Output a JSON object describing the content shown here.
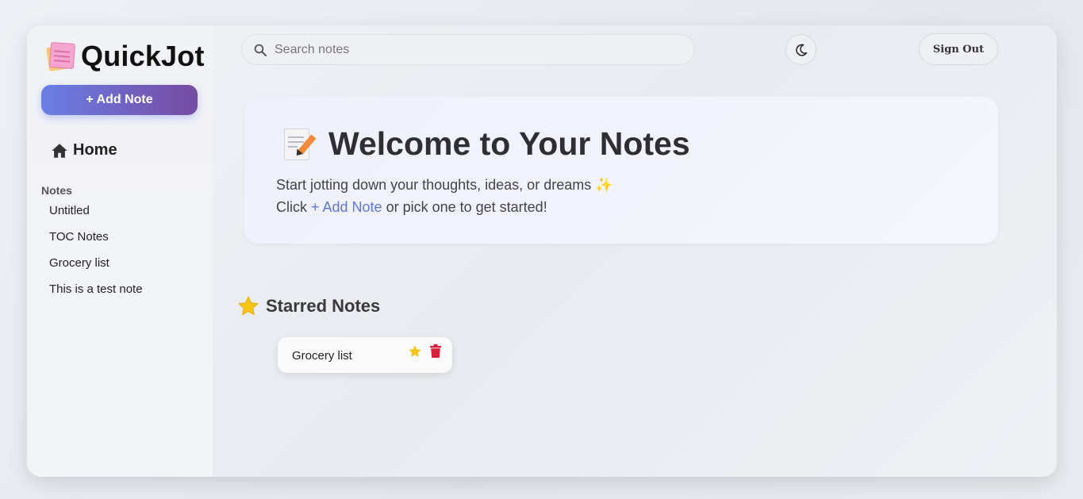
{
  "app": {
    "name": "QuickJot",
    "logo_icon": "sticky-notes-icon"
  },
  "sidebar": {
    "add_note_label": "+ Add Note",
    "home_label": "Home",
    "home_icon": "home-icon",
    "notes_heading": "Notes",
    "notes": [
      {
        "title": "Untitled"
      },
      {
        "title": "TOC Notes"
      },
      {
        "title": "Grocery list"
      },
      {
        "title": "This is a test note"
      }
    ]
  },
  "header": {
    "search_placeholder": "Search notes",
    "search_value": "",
    "theme_icon": "moon-icon",
    "sign_out_label": "Sign Out"
  },
  "welcome": {
    "icon": "memo-icon",
    "title": "Welcome to Your Notes",
    "line1": "Start jotting down your thoughts, ideas, or dreams ✨",
    "line2_prefix": "Click ",
    "line2_link": "+ Add Note",
    "line2_suffix": " or pick one to get started!"
  },
  "starred": {
    "heading": "Starred Notes",
    "icon": "star-icon",
    "cards": [
      {
        "title": "Grocery list",
        "starred": true
      }
    ]
  },
  "colors": {
    "accent_start": "#6a7fe6",
    "accent_end": "#764ba2",
    "link": "#5f78d8",
    "star": "#f5c518",
    "trash": "#d61f3c"
  }
}
